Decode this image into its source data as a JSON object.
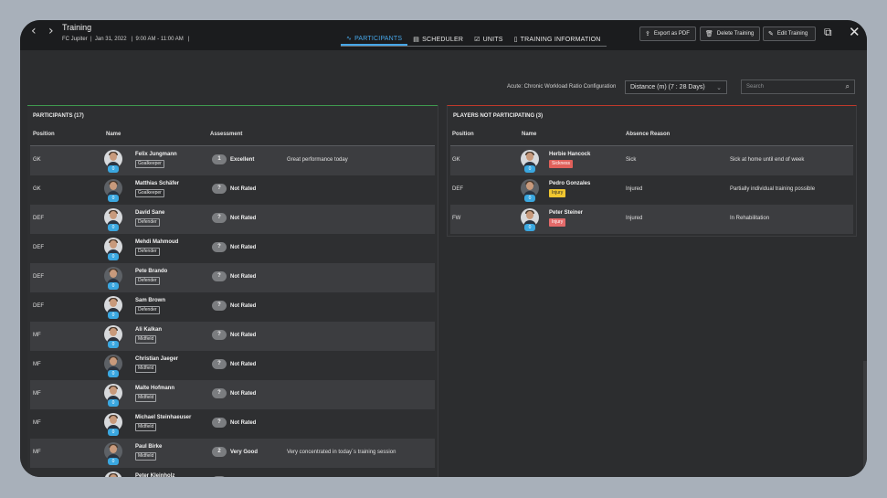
{
  "header": {
    "title": "Training",
    "subtitle": "FC Jupiter  |  Jan 31, 2022   |  9:00 AM - 11:00 AM   |",
    "tabs": [
      {
        "label": "PARTICIPANTS",
        "icon": "activity-icon",
        "active": true
      },
      {
        "label": "SCHEDULER",
        "icon": "clipboard-icon",
        "active": false
      },
      {
        "label": "UNITS",
        "icon": "checklist-icon",
        "active": false
      },
      {
        "label": "TRAINING INFORMATION",
        "icon": "document-icon",
        "active": false
      }
    ],
    "buttons": {
      "export": "Export as PDF",
      "delete": "Delete Training",
      "edit": "Edit Training"
    }
  },
  "config": {
    "label": "Acute: Chronic Workload Ratio Configuration",
    "value": "Distance (m) (7 : 28 Days)",
    "search_placeholder": "Search"
  },
  "participants": {
    "title": "PARTICIPANTS (17)",
    "columns": {
      "position": "Position",
      "name": "Name",
      "assessment": "Assessment"
    },
    "rows": [
      {
        "position": "GK",
        "name": "Felix Jungmann",
        "role": "Goalkeeper",
        "number": "0",
        "score": "1",
        "assessment": "Excellent",
        "comment": "Great performance today"
      },
      {
        "position": "GK",
        "name": "Matthias Schäfer",
        "role": "Goalkeeper",
        "number": "0",
        "score": "?",
        "assessment": "Not Rated",
        "comment": ""
      },
      {
        "position": "DEF",
        "name": "David Sane",
        "role": "Defender",
        "number": "0",
        "score": "?",
        "assessment": "Not Rated",
        "comment": ""
      },
      {
        "position": "DEF",
        "name": "Mehdi Mahmoud",
        "role": "Defender",
        "number": "0",
        "score": "?",
        "assessment": "Not Rated",
        "comment": ""
      },
      {
        "position": "DEF",
        "name": "Pete Brando",
        "role": "Defender",
        "number": "0",
        "score": "?",
        "assessment": "Not Rated",
        "comment": ""
      },
      {
        "position": "DEF",
        "name": "Sam Brown",
        "role": "Defender",
        "number": "0",
        "score": "?",
        "assessment": "Not Rated",
        "comment": ""
      },
      {
        "position": "MF",
        "name": "Ali Kalkan",
        "role": "Midfield",
        "number": "0",
        "score": "?",
        "assessment": "Not Rated",
        "comment": ""
      },
      {
        "position": "MF",
        "name": "Christian Jaeger",
        "role": "Midfield",
        "number": "0",
        "score": "?",
        "assessment": "Not Rated",
        "comment": ""
      },
      {
        "position": "MF",
        "name": "Malte Hofmann",
        "role": "Midfield",
        "number": "0",
        "score": "?",
        "assessment": "Not Rated",
        "comment": ""
      },
      {
        "position": "MF",
        "name": "Michael Steinhaeuser",
        "role": "Midfield",
        "number": "0",
        "score": "?",
        "assessment": "Not Rated",
        "comment": ""
      },
      {
        "position": "MF",
        "name": "Paul Birke",
        "role": "Midfield",
        "number": "0",
        "score": "2",
        "assessment": "Very Good",
        "comment": "Very concentrated in today´s training session"
      },
      {
        "position": "MF",
        "name": "Peter Kleinholz",
        "role": "Midfield",
        "number": "0",
        "score": "?",
        "assessment": "Not Rated",
        "comment": ""
      }
    ]
  },
  "not_participating": {
    "title": "PLAYERS NOT PARTICIPATING (3)",
    "columns": {
      "position": "Position",
      "name": "Name",
      "reason": "Absence Reason"
    },
    "rows": [
      {
        "position": "GK",
        "name": "Herbie Hancock",
        "status": "Sickness",
        "status_color": "#e0605a",
        "number": "0",
        "reason": "Sick",
        "note": "Sick at home until end of week"
      },
      {
        "position": "DEF",
        "name": "Pedro Gonzales",
        "status": "Injury",
        "status_color": "#f0c630",
        "number": "0",
        "reason": "Injured",
        "note": "Partially individual training possible"
      },
      {
        "position": "FW",
        "name": "Peter Steiner",
        "status": "Injury",
        "status_color": "#e36a6a",
        "number": "0",
        "reason": "Injured",
        "note": "In Rehabilitation"
      }
    ]
  },
  "colors": {
    "accent": "#46a6e8",
    "participants_border": "#3f9a4f",
    "absent_border": "#c0392b",
    "number_badge": "#3aa7e0"
  }
}
